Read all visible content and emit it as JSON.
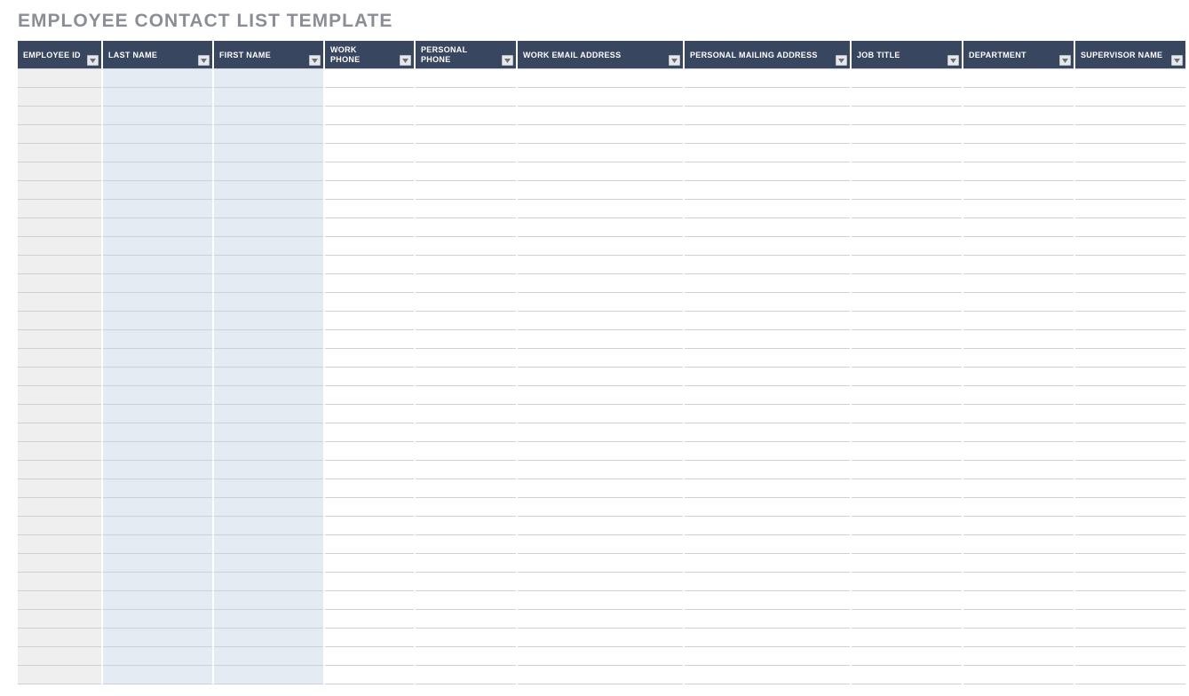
{
  "title": "EMPLOYEE CONTACT LIST TEMPLATE",
  "columns": [
    {
      "label": "EMPLOYEE ID",
      "shade": "a"
    },
    {
      "label": "LAST NAME",
      "shade": "b"
    },
    {
      "label": "FIRST NAME",
      "shade": "b"
    },
    {
      "label": "WORK\nPHONE",
      "shade": "plain"
    },
    {
      "label": "PERSONAL\nPHONE",
      "shade": "plain"
    },
    {
      "label": "WORK EMAIL ADDRESS",
      "shade": "plain"
    },
    {
      "label": "PERSONAL MAILING ADDRESS",
      "shade": "plain"
    },
    {
      "label": "JOB TITLE",
      "shade": "plain"
    },
    {
      "label": "DEPARTMENT",
      "shade": "plain"
    },
    {
      "label": "SUPERVISOR NAME",
      "shade": "plain"
    }
  ],
  "row_count": 33,
  "rows": [
    [
      "",
      "",
      "",
      "",
      "",
      "",
      "",
      "",
      "",
      ""
    ],
    [
      "",
      "",
      "",
      "",
      "",
      "",
      "",
      "",
      "",
      ""
    ],
    [
      "",
      "",
      "",
      "",
      "",
      "",
      "",
      "",
      "",
      ""
    ],
    [
      "",
      "",
      "",
      "",
      "",
      "",
      "",
      "",
      "",
      ""
    ],
    [
      "",
      "",
      "",
      "",
      "",
      "",
      "",
      "",
      "",
      ""
    ],
    [
      "",
      "",
      "",
      "",
      "",
      "",
      "",
      "",
      "",
      ""
    ],
    [
      "",
      "",
      "",
      "",
      "",
      "",
      "",
      "",
      "",
      ""
    ],
    [
      "",
      "",
      "",
      "",
      "",
      "",
      "",
      "",
      "",
      ""
    ],
    [
      "",
      "",
      "",
      "",
      "",
      "",
      "",
      "",
      "",
      ""
    ],
    [
      "",
      "",
      "",
      "",
      "",
      "",
      "",
      "",
      "",
      ""
    ],
    [
      "",
      "",
      "",
      "",
      "",
      "",
      "",
      "",
      "",
      ""
    ],
    [
      "",
      "",
      "",
      "",
      "",
      "",
      "",
      "",
      "",
      ""
    ],
    [
      "",
      "",
      "",
      "",
      "",
      "",
      "",
      "",
      "",
      ""
    ],
    [
      "",
      "",
      "",
      "",
      "",
      "",
      "",
      "",
      "",
      ""
    ],
    [
      "",
      "",
      "",
      "",
      "",
      "",
      "",
      "",
      "",
      ""
    ],
    [
      "",
      "",
      "",
      "",
      "",
      "",
      "",
      "",
      "",
      ""
    ],
    [
      "",
      "",
      "",
      "",
      "",
      "",
      "",
      "",
      "",
      ""
    ],
    [
      "",
      "",
      "",
      "",
      "",
      "",
      "",
      "",
      "",
      ""
    ],
    [
      "",
      "",
      "",
      "",
      "",
      "",
      "",
      "",
      "",
      ""
    ],
    [
      "",
      "",
      "",
      "",
      "",
      "",
      "",
      "",
      "",
      ""
    ],
    [
      "",
      "",
      "",
      "",
      "",
      "",
      "",
      "",
      "",
      ""
    ],
    [
      "",
      "",
      "",
      "",
      "",
      "",
      "",
      "",
      "",
      ""
    ],
    [
      "",
      "",
      "",
      "",
      "",
      "",
      "",
      "",
      "",
      ""
    ],
    [
      "",
      "",
      "",
      "",
      "",
      "",
      "",
      "",
      "",
      ""
    ],
    [
      "",
      "",
      "",
      "",
      "",
      "",
      "",
      "",
      "",
      ""
    ],
    [
      "",
      "",
      "",
      "",
      "",
      "",
      "",
      "",
      "",
      ""
    ],
    [
      "",
      "",
      "",
      "",
      "",
      "",
      "",
      "",
      "",
      ""
    ],
    [
      "",
      "",
      "",
      "",
      "",
      "",
      "",
      "",
      "",
      ""
    ],
    [
      "",
      "",
      "",
      "",
      "",
      "",
      "",
      "",
      "",
      ""
    ],
    [
      "",
      "",
      "",
      "",
      "",
      "",
      "",
      "",
      "",
      ""
    ],
    [
      "",
      "",
      "",
      "",
      "",
      "",
      "",
      "",
      "",
      ""
    ],
    [
      "",
      "",
      "",
      "",
      "",
      "",
      "",
      "",
      "",
      ""
    ],
    [
      "",
      "",
      "",
      "",
      "",
      "",
      "",
      "",
      "",
      ""
    ]
  ]
}
